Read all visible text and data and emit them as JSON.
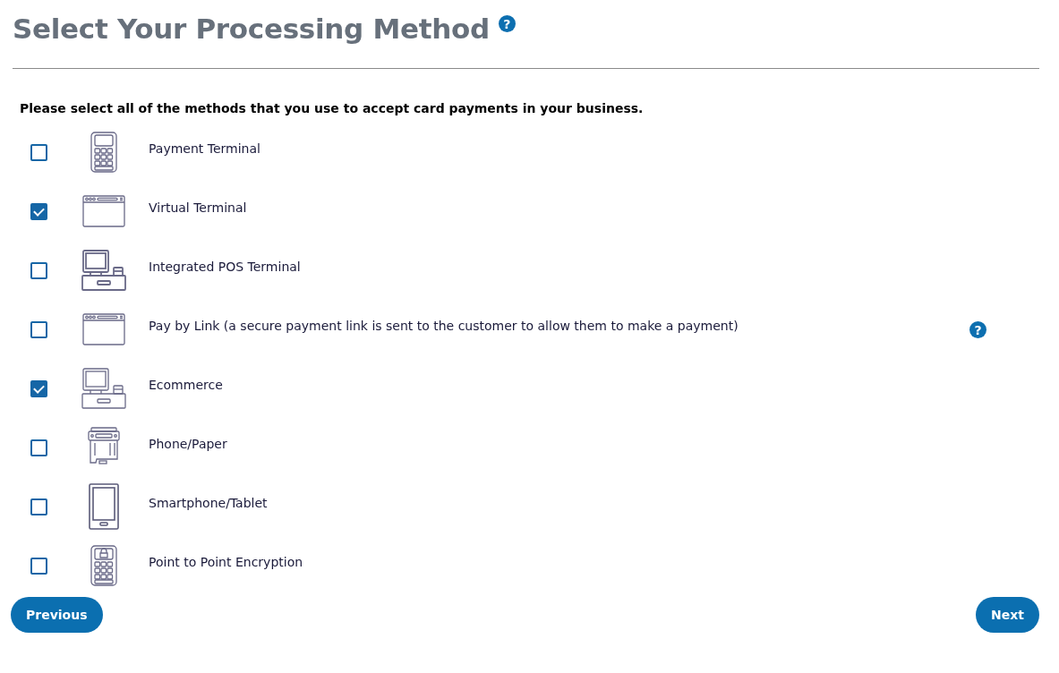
{
  "page": {
    "title": "Select Your Processing Method",
    "title_help": "?"
  },
  "instruction": "Please select all of the methods that you use to accept card payments in your business.",
  "methods": [
    {
      "label": "Payment Terminal",
      "kind": "keypad",
      "checked": false
    },
    {
      "label": "Virtual Terminal",
      "kind": "browser",
      "checked": true
    },
    {
      "label": "Integrated POS Terminal",
      "kind": "register",
      "checked": false
    },
    {
      "label": "Pay by Link (a secure payment link is sent to the customer to allow them to make a payment)",
      "kind": "browser",
      "checked": false,
      "help": "?"
    },
    {
      "label": "Ecommerce",
      "kind": "computer",
      "checked": true
    },
    {
      "label": "Phone/Paper",
      "kind": "imprinter",
      "checked": false
    },
    {
      "label": "Smartphone/Tablet",
      "kind": "phone",
      "checked": false
    },
    {
      "label": "Point to Point Encryption",
      "kind": "lock-keypad",
      "checked": false
    }
  ],
  "buttons": {
    "previous": "Previous",
    "next": "Next"
  }
}
